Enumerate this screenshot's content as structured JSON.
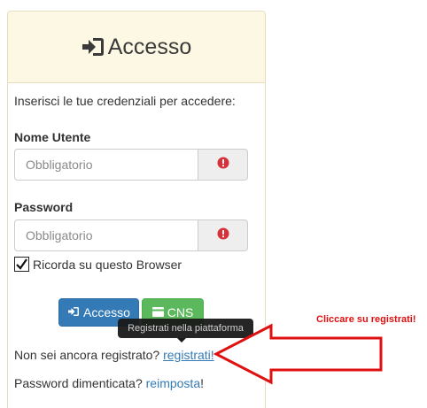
{
  "panel": {
    "title": "Accesso",
    "intro": "Inserisci le tue credenziali per accedere:"
  },
  "username": {
    "label": "Nome Utente",
    "placeholder": "Obbligatorio",
    "value": ""
  },
  "password": {
    "label": "Password",
    "placeholder": "Obbligatorio",
    "value": ""
  },
  "remember": {
    "label": "Ricorda su questo Browser",
    "checked": true
  },
  "buttons": {
    "login": "Accesso",
    "cns": "CNS"
  },
  "tooltip": "Registrati nella piattaforma",
  "register": {
    "prefix": "Non sei ancora registrato? ",
    "link": "registrati!"
  },
  "reset": {
    "prefix": "Password dimenticata? ",
    "link": "reimposta",
    "suffix": "!"
  },
  "annotation": {
    "text": "Cliccare su registrati!",
    "color": "#e01010"
  },
  "colors": {
    "heading_bg": "#fcf8e3",
    "primary": "#337ab7",
    "success": "#5cb85c",
    "required_icon": "#d9303a"
  }
}
